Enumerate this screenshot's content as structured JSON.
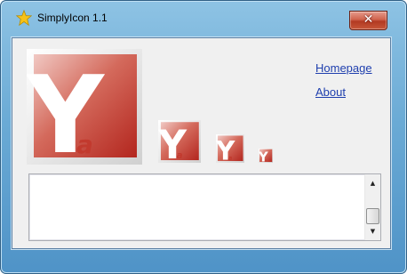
{
  "window": {
    "title": "SimplyIcon 1.1",
    "close_glyph": "✕",
    "app_icon": "star-icon"
  },
  "links": {
    "homepage": "Homepage",
    "about": "About"
  },
  "icon_letters": {
    "main": "Y",
    "sub": "a"
  },
  "textarea": {
    "value": ""
  },
  "colors": {
    "icon_red": "#c23a2e",
    "link": "#1f3fae",
    "close_red": "#c45a3d"
  }
}
